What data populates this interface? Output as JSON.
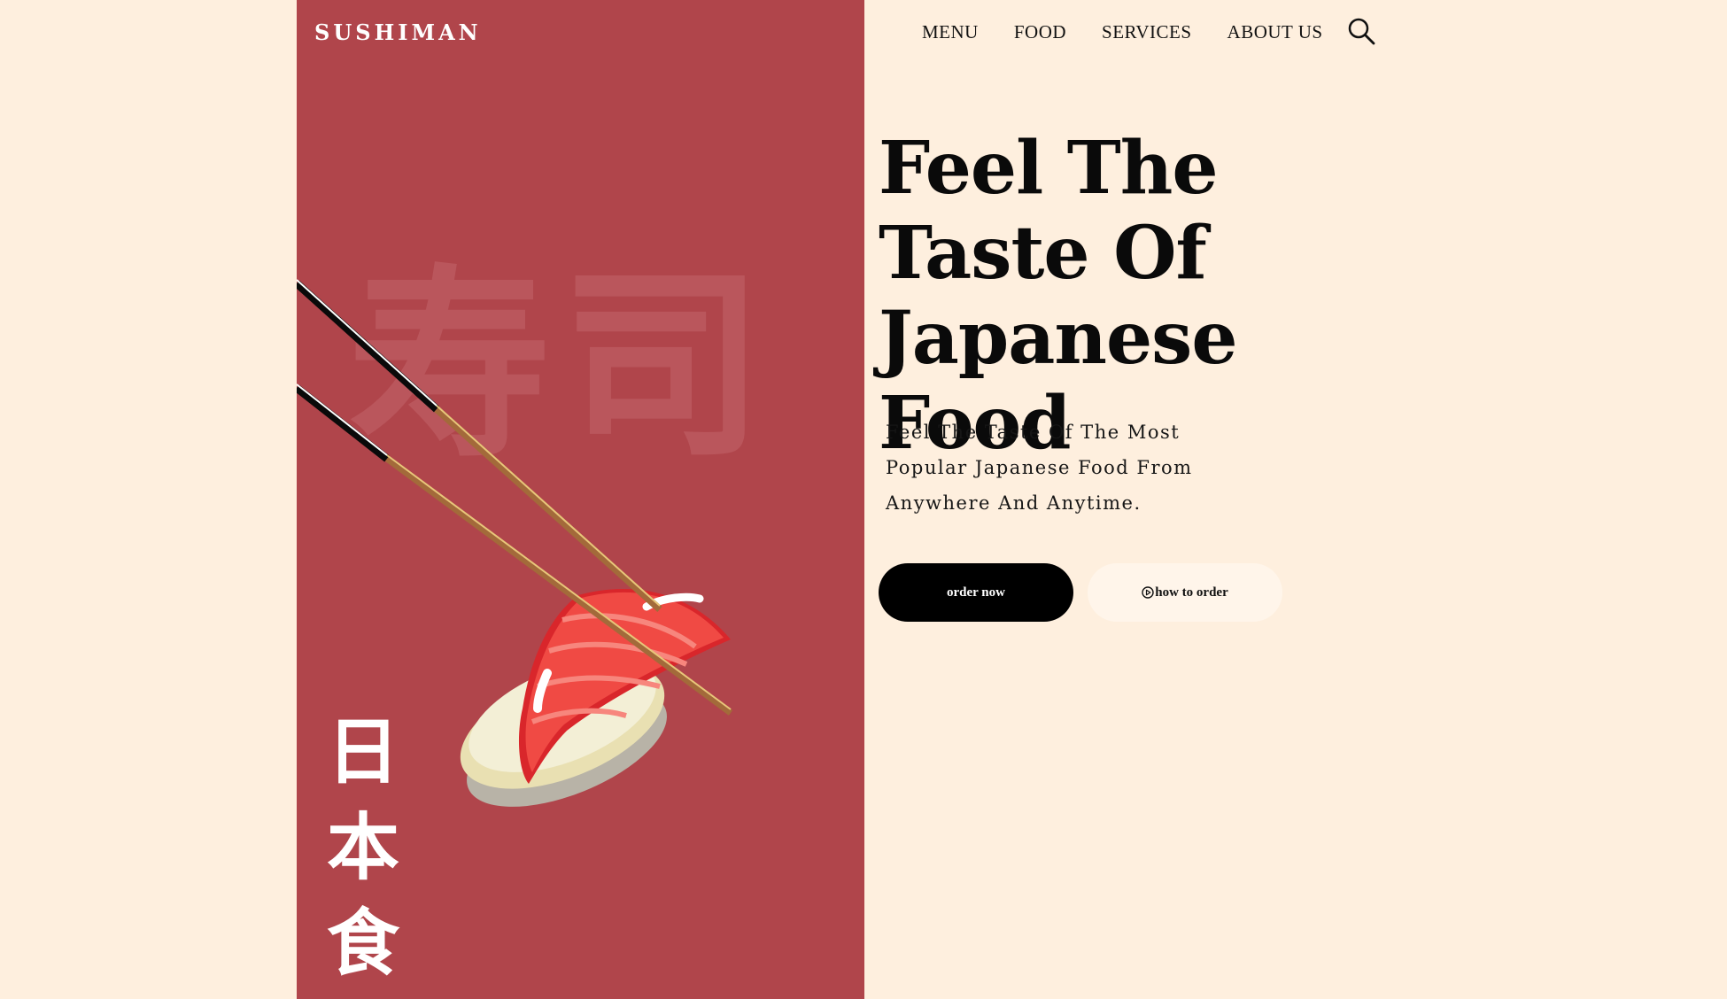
{
  "brand": {
    "name": "SUSHIMAN"
  },
  "nav": {
    "items": [
      {
        "label": "MENU"
      },
      {
        "label": "FOOD"
      },
      {
        "label": "SERVICES"
      },
      {
        "label": "ABOUT US"
      }
    ],
    "search_icon": "search-icon"
  },
  "hero": {
    "title": "Feel The Taste Of Japanese Food",
    "description": "Feel The Taste Of The Most Popular Japanese Food From Anywhere And Anytime.",
    "primary_button": "order now",
    "secondary_button": "how to order",
    "secondary_button_icon": "play-circle-icon"
  },
  "panel": {
    "watermark": "寿司",
    "vertical_text": [
      "日",
      "本",
      "食"
    ]
  },
  "colors": {
    "background": "#feefde",
    "panel_red": "#b0454b",
    "primary_button": "#000000",
    "secondary_button": "#fff5ea"
  }
}
